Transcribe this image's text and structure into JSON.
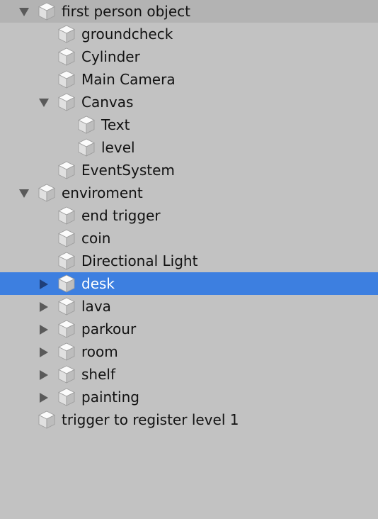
{
  "panel": "hierarchy",
  "colors": {
    "background": "#c2c2c2",
    "first_row_background": "#b3b3b3",
    "selection": "#3d7fe0",
    "text": "#121212",
    "selected_text": "#ffffff"
  },
  "icons": {
    "object": "gameobject-cube-icon",
    "expanded": "triangle-down-icon",
    "collapsed": "triangle-right-icon"
  },
  "rows": [
    {
      "label": "first person object",
      "depth": 0,
      "toggle": "expanded",
      "selected": false
    },
    {
      "label": "groundcheck",
      "depth": 1,
      "toggle": "none",
      "selected": false
    },
    {
      "label": "Cylinder",
      "depth": 1,
      "toggle": "none",
      "selected": false
    },
    {
      "label": "Main Camera",
      "depth": 1,
      "toggle": "none",
      "selected": false
    },
    {
      "label": "Canvas",
      "depth": 1,
      "toggle": "expanded",
      "selected": false
    },
    {
      "label": "Text",
      "depth": 2,
      "toggle": "none",
      "selected": false
    },
    {
      "label": "level",
      "depth": 2,
      "toggle": "none",
      "selected": false
    },
    {
      "label": "EventSystem",
      "depth": 1,
      "toggle": "none",
      "selected": false
    },
    {
      "label": "enviroment",
      "depth": 0,
      "toggle": "expanded",
      "selected": false
    },
    {
      "label": "end trigger",
      "depth": 1,
      "toggle": "none",
      "selected": false
    },
    {
      "label": "coin",
      "depth": 1,
      "toggle": "none",
      "selected": false
    },
    {
      "label": "Directional Light",
      "depth": 1,
      "toggle": "none",
      "selected": false
    },
    {
      "label": "desk",
      "depth": 1,
      "toggle": "collapsed",
      "selected": true
    },
    {
      "label": "lava",
      "depth": 1,
      "toggle": "collapsed",
      "selected": false
    },
    {
      "label": "parkour",
      "depth": 1,
      "toggle": "collapsed",
      "selected": false
    },
    {
      "label": "room",
      "depth": 1,
      "toggle": "collapsed",
      "selected": false
    },
    {
      "label": "shelf",
      "depth": 1,
      "toggle": "collapsed",
      "selected": false
    },
    {
      "label": "painting",
      "depth": 1,
      "toggle": "collapsed",
      "selected": false
    },
    {
      "label": "trigger to register level 1",
      "depth": 0,
      "toggle": "none",
      "selected": false
    }
  ]
}
